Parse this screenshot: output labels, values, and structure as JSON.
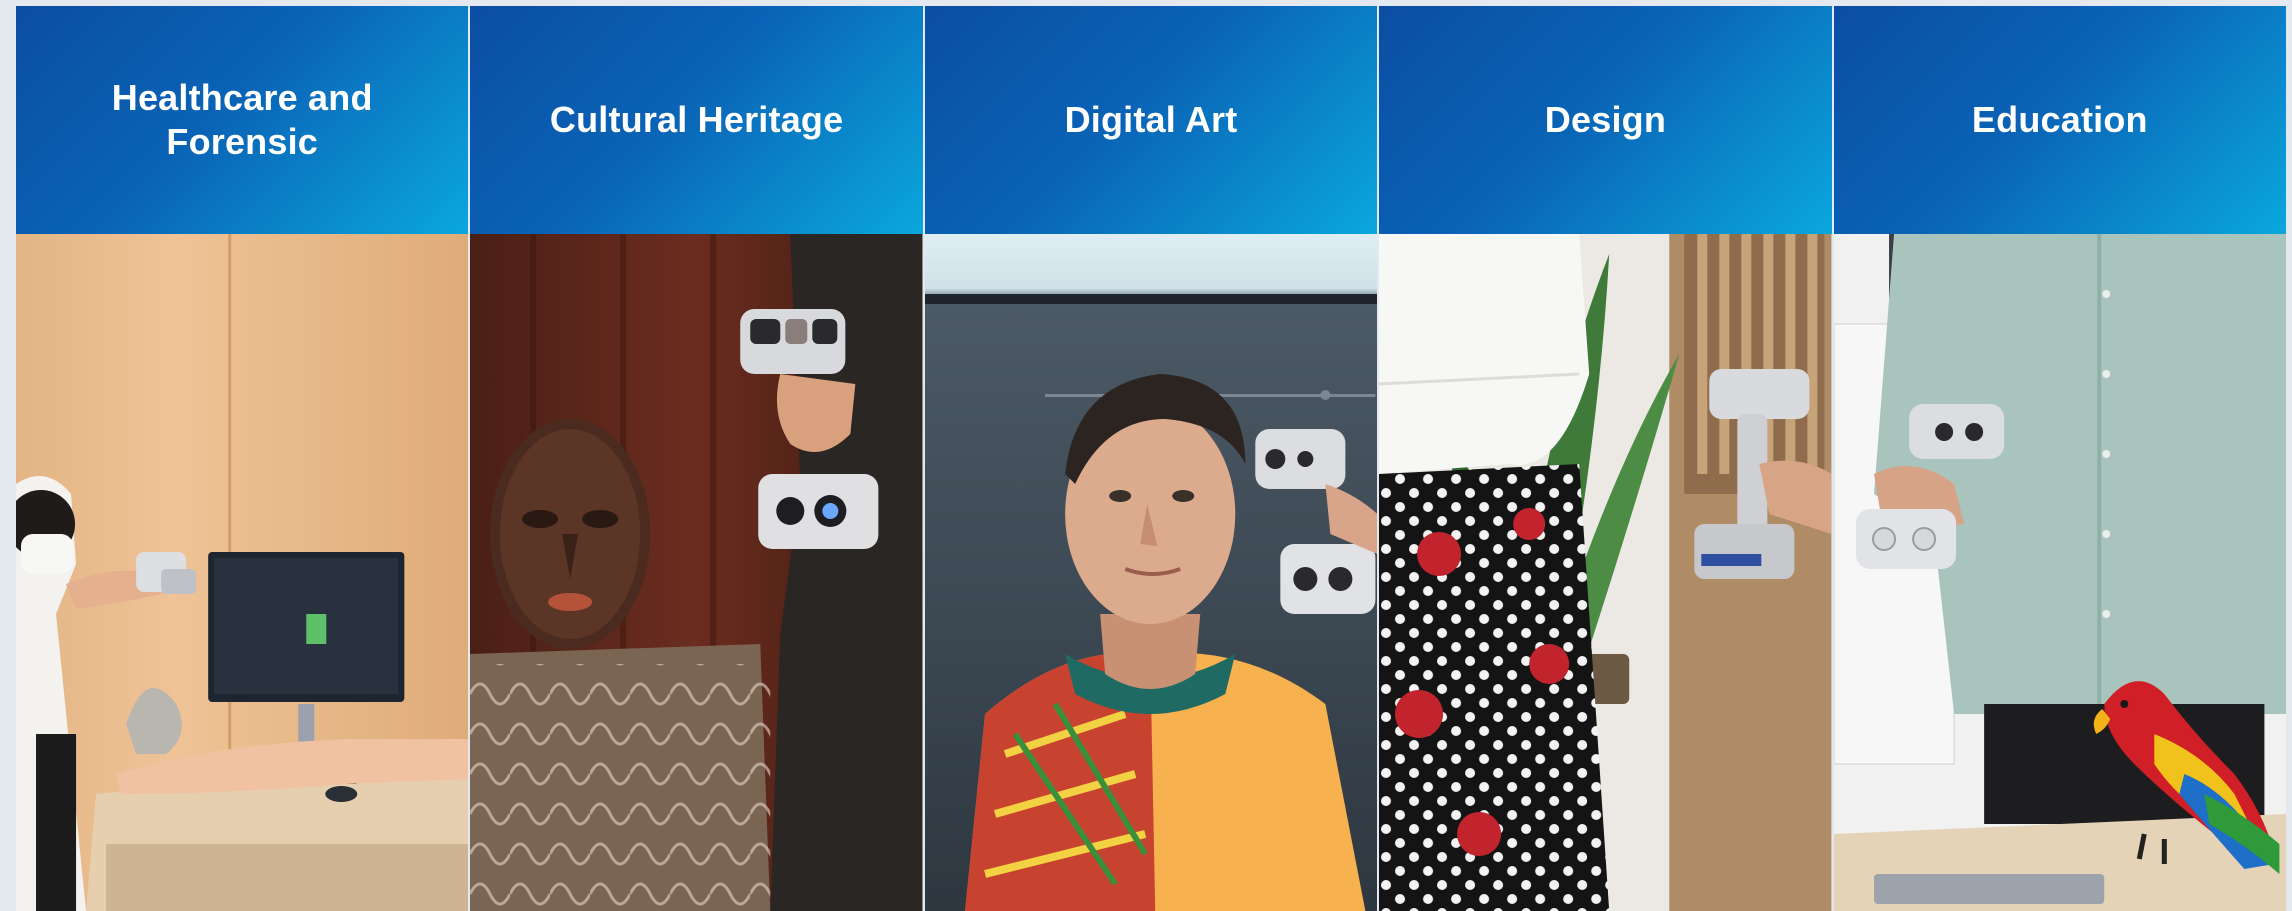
{
  "industries": [
    {
      "title": "Healthcare and\nForensic"
    },
    {
      "title": "Cultural Heritage"
    },
    {
      "title": "Digital Art"
    },
    {
      "title": "Design"
    },
    {
      "title": "Education"
    }
  ],
  "colors": {
    "header_start": "#0b4ea3",
    "header_end": "#0aa7dd",
    "title_text": "#ffffff"
  },
  "icons": [
    "scanner-icon"
  ]
}
